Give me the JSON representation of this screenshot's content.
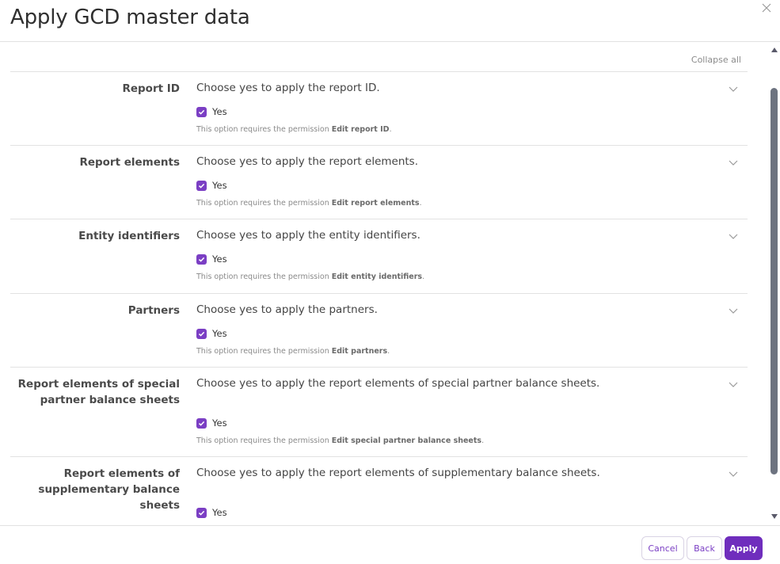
{
  "dialog": {
    "title": "Apply GCD master data"
  },
  "toolbar": {
    "collapse_all": "Collapse all"
  },
  "sections": [
    {
      "label": "Report ID",
      "description": "Choose yes to apply the report ID.",
      "checkbox_label": "Yes",
      "checked": true,
      "permission_prefix": "This option requires the permission ",
      "permission_name": "Edit report ID",
      "permission_suffix": "."
    },
    {
      "label": "Report elements",
      "description": "Choose yes to apply the report elements.",
      "checkbox_label": "Yes",
      "checked": true,
      "permission_prefix": "This option requires the permission ",
      "permission_name": "Edit report elements",
      "permission_suffix": "."
    },
    {
      "label": "Entity identifiers",
      "description": "Choose yes to apply the entity identifiers.",
      "checkbox_label": "Yes",
      "checked": true,
      "permission_prefix": "This option requires the permission ",
      "permission_name": "Edit entity identifiers",
      "permission_suffix": "."
    },
    {
      "label": "Partners",
      "description": "Choose yes to apply the partners.",
      "checkbox_label": "Yes",
      "checked": true,
      "permission_prefix": "This option requires the permission ",
      "permission_name": "Edit partners",
      "permission_suffix": "."
    },
    {
      "label_line1": "Report elements of special",
      "label_line2": "partner balance sheets",
      "description": "Choose yes to apply the report elements of special partner balance sheets.",
      "checkbox_label": "Yes",
      "checked": true,
      "permission_prefix": "This option requires the permission ",
      "permission_name": "Edit special partner balance sheets",
      "permission_suffix": "."
    },
    {
      "label_line1": "Report elements of",
      "label_line2": "supplementary balance sheets",
      "description": "Choose yes to apply the report elements of supplementary balance sheets.",
      "checkbox_label": "Yes",
      "checked": true
    }
  ],
  "footer": {
    "cancel_label": "Cancel",
    "back_label": "Back",
    "apply_label": "Apply"
  },
  "colors": {
    "accent": "#6f2dbd",
    "checkbox": "#7b3fc4",
    "scroll_thumb": "#6d7380"
  },
  "icons": {
    "close": "close-icon",
    "chevron": "chevron-down-icon",
    "check": "checkmark-icon"
  }
}
